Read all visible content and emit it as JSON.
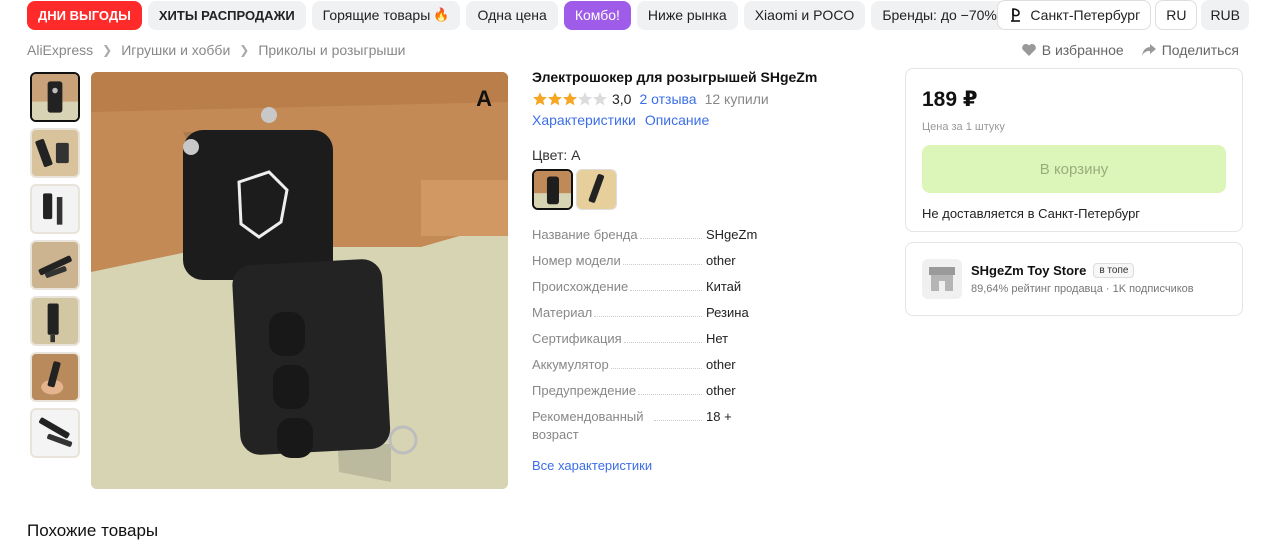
{
  "promo": {
    "chips": [
      {
        "label": "Дни выгоды",
        "style": "red"
      },
      {
        "label": "Хиты распродажи",
        "style": "bold"
      },
      {
        "label": "Горящие товары",
        "style": "plain",
        "icon": "fire-icon"
      },
      {
        "label": "Одна цена",
        "style": "plain"
      },
      {
        "label": "Комбо!",
        "style": "purple"
      },
      {
        "label": "Ниже рынка",
        "style": "plain"
      },
      {
        "label": "Xiaomi и POCO",
        "style": "plain"
      },
      {
        "label": "Бренды: до −70%",
        "style": "plain"
      }
    ],
    "location": "Санкт-Петербург",
    "language": "RU",
    "currency": "RUB"
  },
  "breadcrumb": [
    "AliExpress",
    "Игрушки и хобби",
    "Приколы и розыгрыши"
  ],
  "actions": {
    "favorite": "В избранное",
    "share": "Поделиться"
  },
  "gallery": {
    "image_label": "A",
    "thumb_count": 7
  },
  "product": {
    "title": "Электрошокер для розыгрышей SHgeZm",
    "rating": "3,0",
    "rating_value": 3,
    "rating_max": 5,
    "reviews": "2 отзыва",
    "purchases": "12 купили",
    "tab_characteristics": "Характеристики",
    "tab_description": "Описание",
    "color_label": "Цвет: A",
    "specs": [
      {
        "key": "Название бренда",
        "value": "SHgeZm"
      },
      {
        "key": "Номер модели",
        "value": "other"
      },
      {
        "key": "Происхождение",
        "value": "Китай"
      },
      {
        "key": "Материал",
        "value": "Резина"
      },
      {
        "key": "Сертификация",
        "value": "Нет"
      },
      {
        "key": "Аккумулятор",
        "value": "other"
      },
      {
        "key": "Предупреждение",
        "value": "other"
      },
      {
        "key": "Рекомендованный возраст",
        "value": "18 +"
      }
    ],
    "all_characteristics": "Все характеристики"
  },
  "buy": {
    "price": "189 ₽",
    "price_note": "Цена за 1 штуку",
    "cart_button": "В корзину",
    "delivery": "Не доставляется в Санкт-Петербург"
  },
  "store": {
    "name": "SHgeZm Toy Store",
    "badge": "в топе",
    "meta": "89,64% рейтинг продавца · 1K подписчиков"
  },
  "similar_title": "Похожие товары",
  "colors": {
    "link": "#3b6ee8",
    "promo_red": "#ff2b2b",
    "combo_purple": "#9e5ce8",
    "cart_bg": "#dcf5b8",
    "star": "#f5a623"
  }
}
